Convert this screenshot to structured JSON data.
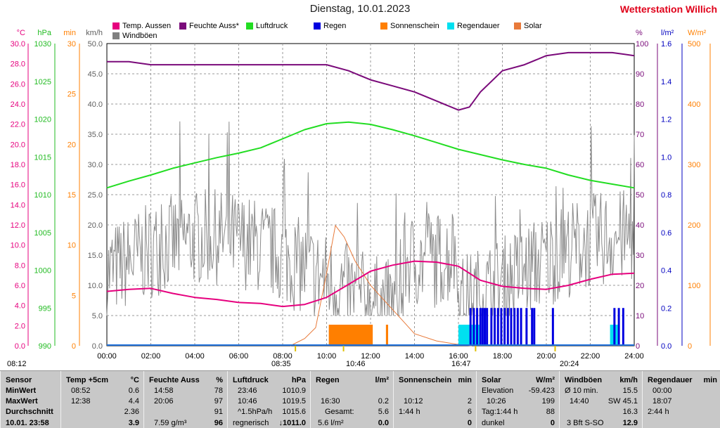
{
  "header": {
    "title": "Dienstag, 10.01.2023",
    "station": "Wetterstation Willich"
  },
  "legend": [
    {
      "name": "Temp. Aussen",
      "color": "#e6007e"
    },
    {
      "name": "Feuchte Auss*",
      "color": "#7a0a7a"
    },
    {
      "name": "Luftdruck",
      "color": "#22dd22"
    },
    {
      "name": "Regen",
      "color": "#0000e0"
    },
    {
      "name": "Sonnenschein",
      "color": "#ff7f00"
    },
    {
      "name": "Regendauer",
      "color": "#00e0f0"
    },
    {
      "name": "Solar",
      "color": "#e87a3a"
    },
    {
      "name": "Windböen",
      "color": "#808080"
    }
  ],
  "axes": {
    "temp": {
      "unit": "°C",
      "ticks": [
        "30.0",
        "28.0",
        "26.0",
        "24.0",
        "22.0",
        "20.0",
        "18.0",
        "16.0",
        "14.0",
        "12.0",
        "10.0",
        "8.0",
        "6.0",
        "4.0",
        "2.0",
        "0.0"
      ],
      "color": "#e6007e"
    },
    "press": {
      "unit": "hPa",
      "ticks": [
        "1030",
        "1025",
        "1020",
        "1015",
        "1010",
        "1005",
        "1000",
        "995",
        "990"
      ],
      "color": "#22bb22"
    },
    "min": {
      "unit": "min",
      "ticks": [
        "30",
        "25",
        "20",
        "15",
        "10",
        "5",
        "0"
      ],
      "color": "#ff7f00"
    },
    "kmh": {
      "unit": "km/h",
      "ticks": [
        "50.0",
        "45.0",
        "40.0",
        "35.0",
        "30.0",
        "25.0",
        "20.0",
        "15.0",
        "10.0",
        "5.0",
        "0.0"
      ],
      "color": "#606060"
    },
    "pct": {
      "unit": "%",
      "ticks": [
        "100",
        "90",
        "80",
        "70",
        "60",
        "50",
        "40",
        "30",
        "20",
        "10",
        "0"
      ],
      "color": "#7a0a7a"
    },
    "rain": {
      "unit": "l/m²",
      "ticks": [
        "1.6",
        "1.4",
        "1.2",
        "1.0",
        "0.8",
        "0.6",
        "0.4",
        "0.2",
        "0.0"
      ],
      "color": "#0000c0"
    },
    "solar": {
      "unit": "W/m²",
      "ticks": [
        "500",
        "400",
        "300",
        "200",
        "100",
        "0"
      ],
      "color": "#ff7f00"
    },
    "x": {
      "ticks": [
        "00:00",
        "02:00",
        "04:00",
        "06:00",
        "08:00",
        "10:00",
        "12:00",
        "14:00",
        "16:00",
        "18:00",
        "20:00",
        "22:00",
        "24:00"
      ]
    }
  },
  "events": {
    "left_time": "08:12",
    "sunrise": "08:35",
    "solar_noon": "10:46",
    "sunset": "16:47",
    "moon": "20:24"
  },
  "chart_data": {
    "type": "line",
    "x_range": [
      0,
      24
    ],
    "temperature_c": [
      [
        0,
        5.4
      ],
      [
        1,
        5.6
      ],
      [
        2,
        5.7
      ],
      [
        3,
        5.2
      ],
      [
        4,
        4.8
      ],
      [
        5,
        4.6
      ],
      [
        6,
        4.3
      ],
      [
        7,
        4.2
      ],
      [
        8,
        3.9
      ],
      [
        9,
        4.1
      ],
      [
        10,
        4.8
      ],
      [
        11,
        6.1
      ],
      [
        12,
        7.4
      ],
      [
        13,
        8.0
      ],
      [
        14,
        8.4
      ],
      [
        15,
        8.3
      ],
      [
        16,
        7.9
      ],
      [
        17,
        6.5
      ],
      [
        18,
        5.9
      ],
      [
        19,
        5.7
      ],
      [
        20,
        5.6
      ],
      [
        21,
        6.0
      ],
      [
        22,
        6.6
      ],
      [
        23,
        7.1
      ],
      [
        24,
        7.2
      ]
    ],
    "humidity_pct": [
      [
        0,
        94
      ],
      [
        1,
        94
      ],
      [
        2,
        93
      ],
      [
        3,
        93
      ],
      [
        4,
        93
      ],
      [
        5,
        93
      ],
      [
        6,
        93
      ],
      [
        7,
        93
      ],
      [
        8,
        93
      ],
      [
        9,
        93
      ],
      [
        10,
        93
      ],
      [
        11,
        91
      ],
      [
        12,
        88
      ],
      [
        13,
        86
      ],
      [
        14,
        84
      ],
      [
        15,
        81
      ],
      [
        16,
        78
      ],
      [
        16.5,
        79
      ],
      [
        17,
        84
      ],
      [
        18,
        91
      ],
      [
        19,
        93
      ],
      [
        20,
        96
      ],
      [
        21,
        97
      ],
      [
        22,
        97
      ],
      [
        23,
        97
      ],
      [
        24,
        96
      ]
    ],
    "pressure_hpa": [
      [
        0,
        1010.9
      ],
      [
        1,
        1011.8
      ],
      [
        2,
        1012.6
      ],
      [
        3,
        1013.5
      ],
      [
        4,
        1014.2
      ],
      [
        5,
        1014.9
      ],
      [
        6,
        1015.5
      ],
      [
        7,
        1016.2
      ],
      [
        8,
        1017.4
      ],
      [
        9,
        1018.6
      ],
      [
        10,
        1019.4
      ],
      [
        11,
        1019.6
      ],
      [
        12,
        1019.3
      ],
      [
        13,
        1018.6
      ],
      [
        14,
        1017.8
      ],
      [
        15,
        1016.9
      ],
      [
        16,
        1016.0
      ],
      [
        17,
        1015.3
      ],
      [
        18,
        1014.6
      ],
      [
        19,
        1014.0
      ],
      [
        20,
        1013.5
      ],
      [
        21,
        1012.6
      ],
      [
        22,
        1011.9
      ],
      [
        23,
        1011.4
      ],
      [
        24,
        1010.9
      ]
    ],
    "solar_wm2": [
      [
        8.35,
        0
      ],
      [
        9,
        12
      ],
      [
        9.5,
        30
      ],
      [
        10,
        120
      ],
      [
        10.4,
        199
      ],
      [
        10.8,
        180
      ],
      [
        11.3,
        140
      ],
      [
        12,
        100
      ],
      [
        12.5,
        80
      ],
      [
        13,
        60
      ],
      [
        13.5,
        40
      ],
      [
        14,
        20
      ],
      [
        15,
        8
      ],
      [
        16,
        2
      ],
      [
        16.6,
        0
      ]
    ],
    "sunshine_min": [
      [
        10.1,
        12.1,
        1.44
      ],
      [
        12.7,
        12.8,
        1.0
      ]
    ],
    "rain_l_m2": {
      "times": [
        16.55,
        16.7,
        16.85,
        17.0,
        17.1,
        17.2,
        17.3,
        17.5,
        17.65,
        17.8,
        17.95,
        18.1,
        18.25,
        18.4,
        18.55,
        18.7,
        18.85,
        19.1,
        19.35,
        19.45,
        20.3,
        23.1,
        23.3,
        23.5
      ],
      "value": 0.2
    },
    "rain_duration": [
      [
        16.0,
        17.0
      ],
      [
        22.9,
        23.3
      ]
    ],
    "wind_gust_kmh": {
      "max": 45.1,
      "mean": 16.3,
      "range": [
        5,
        45
      ]
    }
  },
  "table": {
    "columns": [
      {
        "title": "Sensor",
        "unit": "",
        "rows": [
          [
            "MinWert",
            ""
          ],
          [
            "MaxWert",
            ""
          ],
          [
            "Durchschnitt",
            ""
          ],
          [
            "10.01. 23:58",
            ""
          ]
        ]
      },
      {
        "title": "Temp +5cm",
        "unit": "°C",
        "rows": [
          [
            "08:52",
            "0.6"
          ],
          [
            "12:38",
            "4.4"
          ],
          [
            "",
            "2.36"
          ],
          [
            "",
            "3.9"
          ]
        ]
      },
      {
        "title": "Feuchte Auss",
        "unit": "%",
        "rows": [
          [
            "14:58",
            "78"
          ],
          [
            "20:06",
            "97"
          ],
          [
            "",
            "91"
          ],
          [
            "7.59 g/m³",
            "96"
          ]
        ]
      },
      {
        "title": "Luftdruck",
        "unit": "hPa",
        "rows": [
          [
            "23:46",
            "1010.9"
          ],
          [
            "10:46",
            "1019.5"
          ],
          [
            "^1.5hPa/h",
            "1015.6"
          ],
          [
            "regnerisch",
            "↓1011.0"
          ]
        ]
      },
      {
        "title": "Regen",
        "unit": "l/m²",
        "rows": [
          [
            "",
            ""
          ],
          [
            "16:30",
            "0.2"
          ],
          [
            "Gesamt:",
            "5.6"
          ],
          [
            "5.6 l/m²",
            "0.0"
          ]
        ]
      },
      {
        "title": "Sonnenschein",
        "unit": "min",
        "rows": [
          [
            "",
            ""
          ],
          [
            "10:12",
            "2"
          ],
          [
            "1:44 h",
            "6"
          ],
          [
            "",
            "0"
          ]
        ]
      },
      {
        "title": "Solar",
        "unit": "W/m²",
        "rows": [
          [
            "Elevation",
            "-59.423"
          ],
          [
            "10:26",
            "199"
          ],
          [
            "Tag:1:44 h",
            "88"
          ],
          [
            "dunkel",
            "0"
          ]
        ]
      },
      {
        "title": "Windböen",
        "unit": "km/h",
        "rows": [
          [
            "Ø 10 min.",
            "15.5"
          ],
          [
            "14:40",
            "SW 45.1"
          ],
          [
            "",
            "16.3"
          ],
          [
            "3 Bft S-SO",
            "12.9"
          ]
        ]
      },
      {
        "title": "Regendauer",
        "unit": "min",
        "rows": [
          [
            "00:00",
            ""
          ],
          [
            "18:07",
            ""
          ],
          [
            "2:44 h",
            ""
          ],
          [
            "",
            ""
          ]
        ]
      }
    ]
  }
}
